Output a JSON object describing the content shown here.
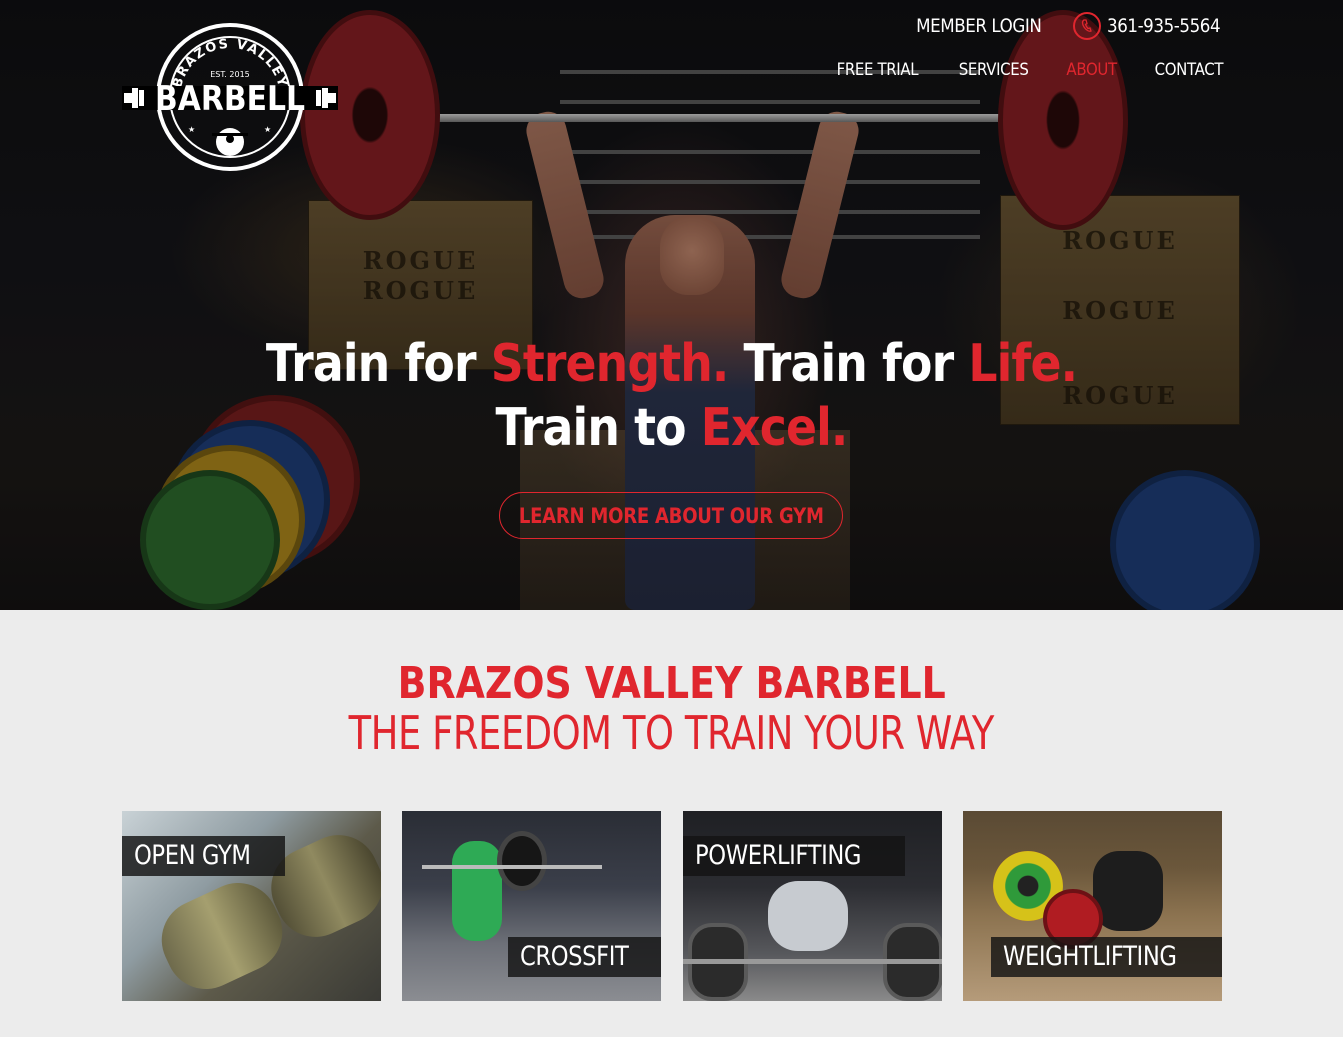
{
  "header": {
    "logo": {
      "name": "BRAZOS VALLEY",
      "wordmark": "BARBELL",
      "est": "EST. 2015"
    },
    "member_login": "MEMBER LOGIN",
    "phone": "361-935-5564",
    "phone_icon": "phone-icon",
    "nav": [
      {
        "label": "FREE TRIAL",
        "active": false
      },
      {
        "label": "SERVICES",
        "active": false
      },
      {
        "label": "ABOUT",
        "active": true
      },
      {
        "label": "CONTACT",
        "active": false
      }
    ]
  },
  "hero": {
    "line1": {
      "a": "Train for ",
      "b": "Strength.",
      "c": " Train for ",
      "d": "Life."
    },
    "line2": {
      "a": "Train to ",
      "b": "Excel."
    },
    "cta": "LEARN MORE ABOUT OUR GYM",
    "crate_text": "ROGUE"
  },
  "intro": {
    "title": "BRAZOS VALLEY BARBELL",
    "subtitle": "THE FREEDOM TO TRAIN YOUR WAY"
  },
  "cards": [
    {
      "label": "OPEN GYM"
    },
    {
      "label": "CROSSFIT"
    },
    {
      "label": "POWERLIFTING"
    },
    {
      "label": "WEIGHTLIFTING"
    }
  ],
  "colors": {
    "accent": "#e0262e",
    "page_bg": "#ececec",
    "hero_bg": "#111114"
  }
}
